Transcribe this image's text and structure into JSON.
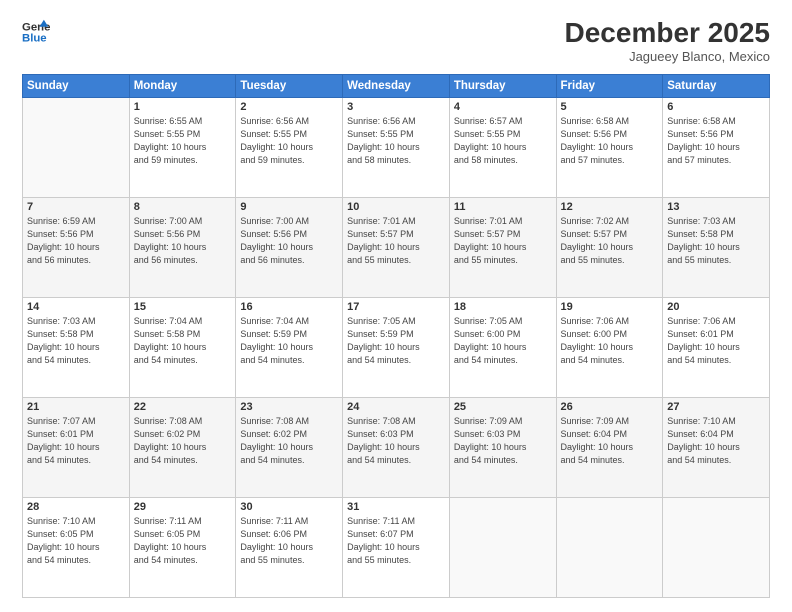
{
  "header": {
    "logo_line1": "General",
    "logo_line2": "Blue",
    "month": "December 2025",
    "location": "Jagueey Blanco, Mexico"
  },
  "days_of_week": [
    "Sunday",
    "Monday",
    "Tuesday",
    "Wednesday",
    "Thursday",
    "Friday",
    "Saturday"
  ],
  "weeks": [
    [
      {
        "day": "",
        "info": ""
      },
      {
        "day": "1",
        "info": "Sunrise: 6:55 AM\nSunset: 5:55 PM\nDaylight: 10 hours\nand 59 minutes."
      },
      {
        "day": "2",
        "info": "Sunrise: 6:56 AM\nSunset: 5:55 PM\nDaylight: 10 hours\nand 59 minutes."
      },
      {
        "day": "3",
        "info": "Sunrise: 6:56 AM\nSunset: 5:55 PM\nDaylight: 10 hours\nand 58 minutes."
      },
      {
        "day": "4",
        "info": "Sunrise: 6:57 AM\nSunset: 5:55 PM\nDaylight: 10 hours\nand 58 minutes."
      },
      {
        "day": "5",
        "info": "Sunrise: 6:58 AM\nSunset: 5:56 PM\nDaylight: 10 hours\nand 57 minutes."
      },
      {
        "day": "6",
        "info": "Sunrise: 6:58 AM\nSunset: 5:56 PM\nDaylight: 10 hours\nand 57 minutes."
      }
    ],
    [
      {
        "day": "7",
        "info": "Sunrise: 6:59 AM\nSunset: 5:56 PM\nDaylight: 10 hours\nand 56 minutes."
      },
      {
        "day": "8",
        "info": "Sunrise: 7:00 AM\nSunset: 5:56 PM\nDaylight: 10 hours\nand 56 minutes."
      },
      {
        "day": "9",
        "info": "Sunrise: 7:00 AM\nSunset: 5:56 PM\nDaylight: 10 hours\nand 56 minutes."
      },
      {
        "day": "10",
        "info": "Sunrise: 7:01 AM\nSunset: 5:57 PM\nDaylight: 10 hours\nand 55 minutes."
      },
      {
        "day": "11",
        "info": "Sunrise: 7:01 AM\nSunset: 5:57 PM\nDaylight: 10 hours\nand 55 minutes."
      },
      {
        "day": "12",
        "info": "Sunrise: 7:02 AM\nSunset: 5:57 PM\nDaylight: 10 hours\nand 55 minutes."
      },
      {
        "day": "13",
        "info": "Sunrise: 7:03 AM\nSunset: 5:58 PM\nDaylight: 10 hours\nand 55 minutes."
      }
    ],
    [
      {
        "day": "14",
        "info": "Sunrise: 7:03 AM\nSunset: 5:58 PM\nDaylight: 10 hours\nand 54 minutes."
      },
      {
        "day": "15",
        "info": "Sunrise: 7:04 AM\nSunset: 5:58 PM\nDaylight: 10 hours\nand 54 minutes."
      },
      {
        "day": "16",
        "info": "Sunrise: 7:04 AM\nSunset: 5:59 PM\nDaylight: 10 hours\nand 54 minutes."
      },
      {
        "day": "17",
        "info": "Sunrise: 7:05 AM\nSunset: 5:59 PM\nDaylight: 10 hours\nand 54 minutes."
      },
      {
        "day": "18",
        "info": "Sunrise: 7:05 AM\nSunset: 6:00 PM\nDaylight: 10 hours\nand 54 minutes."
      },
      {
        "day": "19",
        "info": "Sunrise: 7:06 AM\nSunset: 6:00 PM\nDaylight: 10 hours\nand 54 minutes."
      },
      {
        "day": "20",
        "info": "Sunrise: 7:06 AM\nSunset: 6:01 PM\nDaylight: 10 hours\nand 54 minutes."
      }
    ],
    [
      {
        "day": "21",
        "info": "Sunrise: 7:07 AM\nSunset: 6:01 PM\nDaylight: 10 hours\nand 54 minutes."
      },
      {
        "day": "22",
        "info": "Sunrise: 7:08 AM\nSunset: 6:02 PM\nDaylight: 10 hours\nand 54 minutes."
      },
      {
        "day": "23",
        "info": "Sunrise: 7:08 AM\nSunset: 6:02 PM\nDaylight: 10 hours\nand 54 minutes."
      },
      {
        "day": "24",
        "info": "Sunrise: 7:08 AM\nSunset: 6:03 PM\nDaylight: 10 hours\nand 54 minutes."
      },
      {
        "day": "25",
        "info": "Sunrise: 7:09 AM\nSunset: 6:03 PM\nDaylight: 10 hours\nand 54 minutes."
      },
      {
        "day": "26",
        "info": "Sunrise: 7:09 AM\nSunset: 6:04 PM\nDaylight: 10 hours\nand 54 minutes."
      },
      {
        "day": "27",
        "info": "Sunrise: 7:10 AM\nSunset: 6:04 PM\nDaylight: 10 hours\nand 54 minutes."
      }
    ],
    [
      {
        "day": "28",
        "info": "Sunrise: 7:10 AM\nSunset: 6:05 PM\nDaylight: 10 hours\nand 54 minutes."
      },
      {
        "day": "29",
        "info": "Sunrise: 7:11 AM\nSunset: 6:05 PM\nDaylight: 10 hours\nand 54 minutes."
      },
      {
        "day": "30",
        "info": "Sunrise: 7:11 AM\nSunset: 6:06 PM\nDaylight: 10 hours\nand 55 minutes."
      },
      {
        "day": "31",
        "info": "Sunrise: 7:11 AM\nSunset: 6:07 PM\nDaylight: 10 hours\nand 55 minutes."
      },
      {
        "day": "",
        "info": ""
      },
      {
        "day": "",
        "info": ""
      },
      {
        "day": "",
        "info": ""
      }
    ]
  ]
}
